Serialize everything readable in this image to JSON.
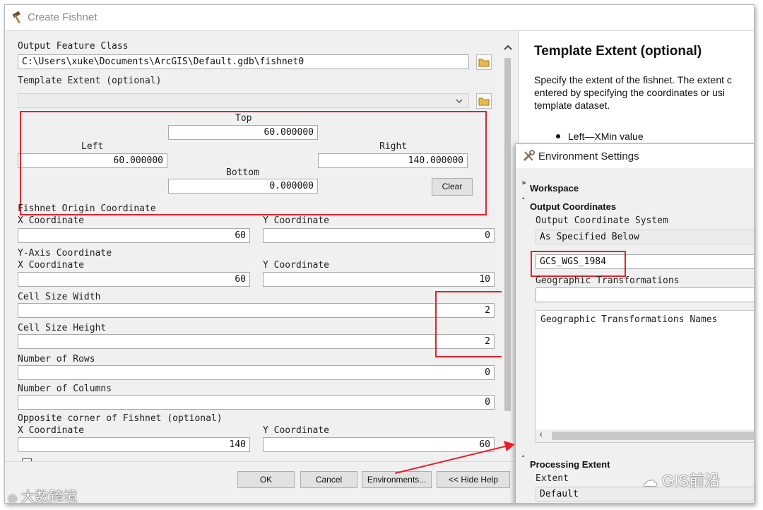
{
  "window": {
    "title": "Create Fishnet"
  },
  "form": {
    "output_feature_class": {
      "label": "Output Feature Class",
      "value": "C:\\Users\\xuke\\Documents\\ArcGIS\\Default.gdb\\fishnet0"
    },
    "template_extent": {
      "label": "Template Extent (optional)",
      "value": "",
      "top_label": "Top",
      "top_value": "60.000000",
      "left_label": "Left",
      "left_value": "60.000000",
      "right_label": "Right",
      "right_value": "140.000000",
      "bottom_label": "Bottom",
      "bottom_value": "0.000000",
      "clear_label": "Clear"
    },
    "origin": {
      "label": "Fishnet Origin Coordinate",
      "x_label": "X Coordinate",
      "x_value": "60",
      "y_label": "Y Coordinate",
      "y_value": "0"
    },
    "y_axis": {
      "label": "Y-Axis Coordinate",
      "x_label": "X Coordinate",
      "x_value": "60",
      "y_label": "Y Coordinate",
      "y_value": "10"
    },
    "cell_width": {
      "label": "Cell Size Width",
      "value": "2"
    },
    "cell_height": {
      "label": "Cell Size Height",
      "value": "2"
    },
    "rows": {
      "label": "Number of Rows",
      "value": "0"
    },
    "columns": {
      "label": "Number of Columns",
      "value": "0"
    },
    "opposite": {
      "label": "Opposite corner of Fishnet (optional)",
      "x_label": "X Coordinate",
      "x_value": "140",
      "y_label": "Y Coordinate",
      "y_value": "60"
    }
  },
  "buttons": {
    "ok": "OK",
    "cancel": "Cancel",
    "environments": "Environments...",
    "hide_help": "<< Hide Help"
  },
  "help": {
    "title": "Template Extent (optional)",
    "text_lines": [
      "Specify the extent of the fishnet. The extent c",
      "entered by specifying the coordinates or usi",
      "template dataset."
    ],
    "bullet": "Left—XMin value"
  },
  "env": {
    "title": "Environment Settings",
    "workspace": "Workspace",
    "output_coordinates": "Output Coordinates",
    "ocs_label": "Output Coordinate System",
    "ocs_value": "As Specified Below",
    "gcs_value": "GCS_WGS_1984",
    "geo_trans_label": "Geographic Transformations",
    "geo_trans_names": "Geographic Transformations Names",
    "processing_extent": "Processing Extent",
    "extent_label": "Extent",
    "extent_value": "Default"
  },
  "watermarks": {
    "left": "大数跨境",
    "right": "GIS前沿"
  },
  "colors": {
    "highlight": "#e8202b",
    "background": "#f0f0f0"
  }
}
